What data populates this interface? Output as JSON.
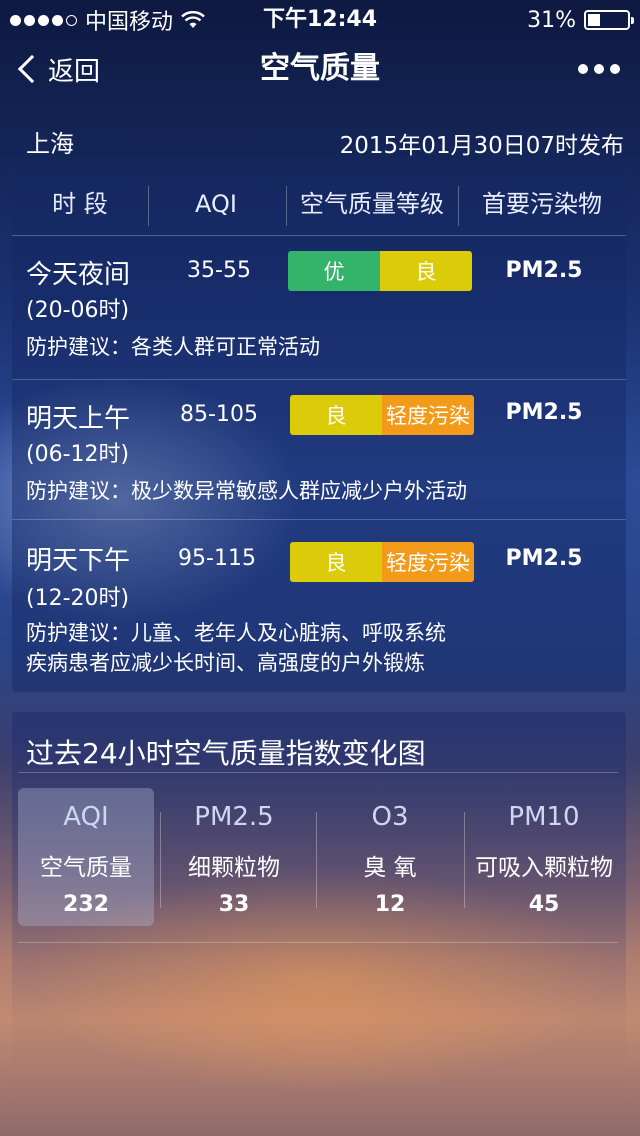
{
  "status_bar": {
    "carrier": "中国移动",
    "time": "下午12:44",
    "battery_text": "31%",
    "battery_level": 0.31,
    "signal_dots_filled": 4
  },
  "nav": {
    "back_label": "返回",
    "title": "空气质量"
  },
  "header": {
    "city": "上海",
    "published": "2015年01月30日07时发布"
  },
  "forecast": {
    "columns": [
      "时 段",
      "AQI",
      "空气质量等级",
      "首要污染物"
    ],
    "rows": [
      {
        "period": "今天夜间",
        "hours": "(20-06时)",
        "aqi": "35-55",
        "levels": [
          {
            "label": "优",
            "color": "#34b36b"
          },
          {
            "label": "良",
            "color": "#dccb08"
          }
        ],
        "pollutant": "PM2.5",
        "advice_lines": [
          "防护建议：各类人群可正常活动"
        ]
      },
      {
        "period": "明天上午",
        "hours": "(06-12时)",
        "aqi": "85-105",
        "levels": [
          {
            "label": "良",
            "color": "#dccb08"
          },
          {
            "label": "轻度污染",
            "color": "#f39a18"
          }
        ],
        "pollutant": "PM2.5",
        "advice_lines": [
          "防护建议：极少数异常敏感人群应减少户外活动"
        ]
      },
      {
        "period": "明天下午",
        "hours": "(12-20时)",
        "aqi": "95-115",
        "levels": [
          {
            "label": "良",
            "color": "#dccb08"
          },
          {
            "label": "轻度污染",
            "color": "#f39a18"
          }
        ],
        "pollutant": "PM2.5",
        "advice_lines": [
          "防护建议：儿童、老年人及心脏病、呼吸系统",
          "疾病患者应减少长时间、高强度的户外锻炼"
        ]
      }
    ]
  },
  "chart_section": {
    "title": "过去24小时空气质量指数变化图",
    "tabs": [
      {
        "code": "AQI",
        "name": "空气质量",
        "value": "232",
        "active": true
      },
      {
        "code": "PM2.5",
        "name": "细颗粒物",
        "value": "33",
        "active": false
      },
      {
        "code": "O3",
        "name": "臭  氧",
        "value": "12",
        "active": false
      },
      {
        "code": "PM10",
        "name": "可吸入颗粒物",
        "value": "45",
        "active": false
      }
    ]
  }
}
